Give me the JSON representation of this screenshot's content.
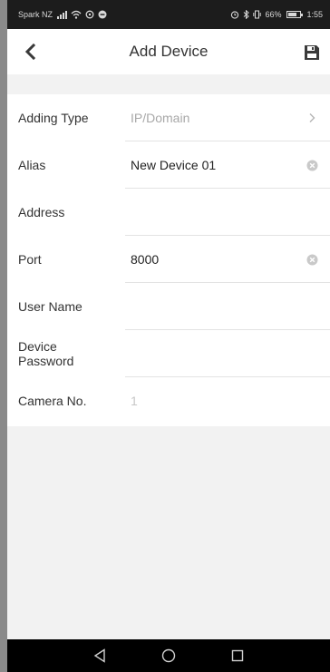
{
  "status_bar": {
    "carrier": "Spark NZ",
    "battery_text": "66%",
    "time": "1:55"
  },
  "header": {
    "title": "Add Device"
  },
  "form": {
    "adding_type": {
      "label": "Adding Type",
      "value": "IP/Domain"
    },
    "alias": {
      "label": "Alias",
      "value": "New Device 01"
    },
    "address": {
      "label": "Address",
      "value": ""
    },
    "port": {
      "label": "Port",
      "value": "8000"
    },
    "user_name": {
      "label": "User Name",
      "value": ""
    },
    "device_password": {
      "label": "Device Password",
      "value": ""
    },
    "camera_no": {
      "label": "Camera No.",
      "value": "1"
    }
  },
  "icons": {
    "back": "back-chevron-icon",
    "save": "floppy-disk-icon",
    "chevron": "chevron-right-icon",
    "clear": "clear-circle-icon",
    "android_back": "triangle-back-icon",
    "android_home": "circle-home-icon",
    "android_recents": "square-recents-icon"
  },
  "colors": {
    "status_bar_bg": "#1c1c1c",
    "header_bg": "#ffffff",
    "page_bg": "#f2f2f2",
    "text_primary": "#333333",
    "text_muted": "#a8a8a8",
    "divider": "#e3e3e3"
  }
}
